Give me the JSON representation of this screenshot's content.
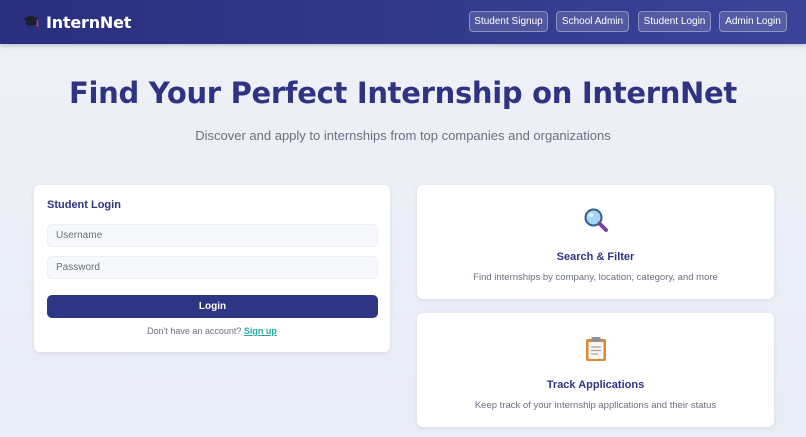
{
  "header": {
    "brand": "InternNet",
    "nav": [
      {
        "label": "Student Signup"
      },
      {
        "label": "School Admin"
      },
      {
        "label": "Student Login"
      },
      {
        "label": "Admin Login"
      }
    ]
  },
  "hero": {
    "title": "Find Your Perfect Internship on InternNet",
    "subtitle": "Discover and apply to internships from top companies and organizations"
  },
  "login": {
    "title": "Student Login",
    "username_placeholder": "Username",
    "password_placeholder": "Password",
    "button": "Login",
    "signup_prompt": "Don't have an account?",
    "signup_link": "Sign up"
  },
  "features": [
    {
      "icon": "magnifying-glass-icon",
      "title": "Search & Filter",
      "description": "Find internships by company, location, category, and more"
    },
    {
      "icon": "clipboard-icon",
      "title": "Track Applications",
      "description": "Keep track of your internship applications and their status"
    }
  ],
  "colors": {
    "header": "#2a2f7c",
    "primary": "#2f3585",
    "accent_link": "#29a8a0",
    "muted_text": "#6b6f80"
  }
}
